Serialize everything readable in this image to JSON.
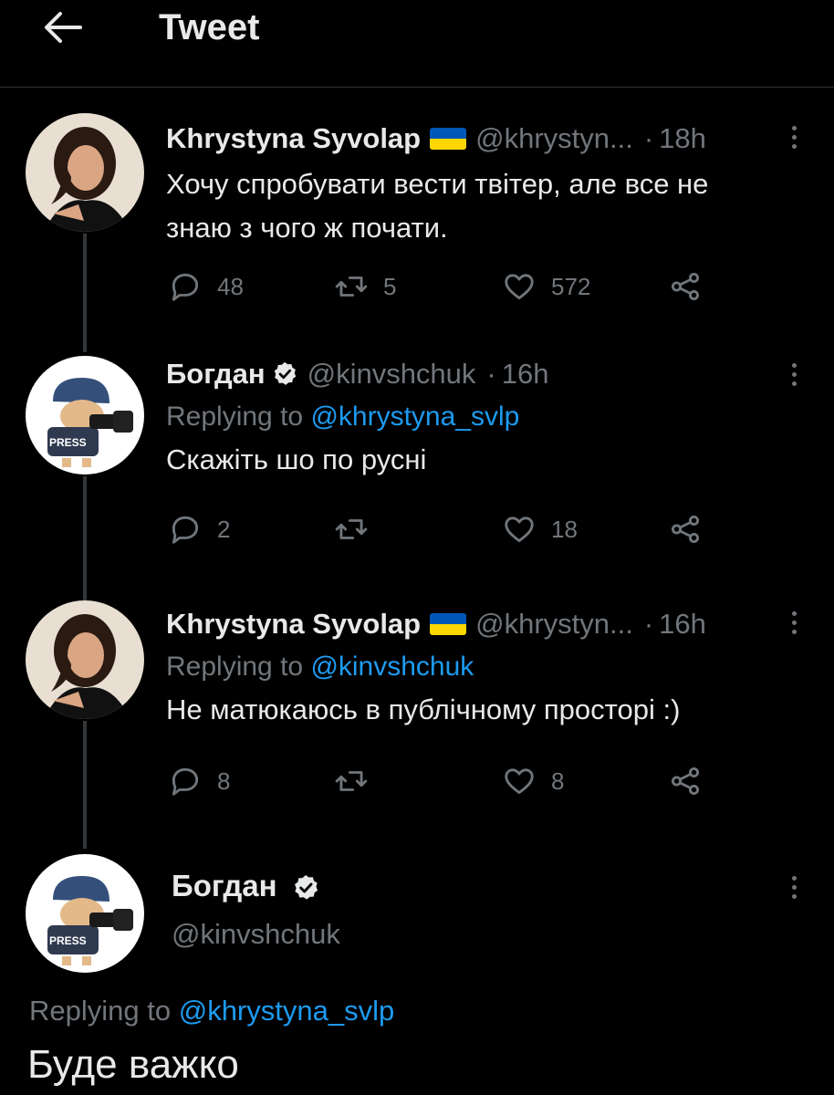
{
  "header": {
    "title": "Tweet",
    "back_icon": "arrow-left-icon"
  },
  "colors": {
    "background": "#000000",
    "text": "#e7e9ea",
    "muted": "#71767b",
    "link": "#1d9bf0",
    "flag_blue": "#0057b7",
    "flag_yellow": "#ffd700"
  },
  "tweets": [
    {
      "name": "Khrystyna Syvolap",
      "handle": "@khrystyn...",
      "dot": "·",
      "time": "18h",
      "replying_prefix": "",
      "replying_to": "",
      "text_line1": "Хочу спробувати вести твітер, але все не",
      "text_line2": "знаю з чого ж почати.",
      "replies": "48",
      "retweets": "5",
      "likes": "572"
    },
    {
      "name": "Богдан",
      "handle": "@kinvshchuk",
      "dot": "·",
      "time": "16h",
      "replying_prefix": "Replying to",
      "replying_to": "@khrystyna_svlp",
      "text": "Скажіть шо по русні",
      "replies": "2",
      "retweets": "",
      "likes": "18"
    },
    {
      "name": "Khrystyna Syvolap",
      "handle": "@khrystyn...",
      "dot": "·",
      "time": "16h",
      "replying_prefix": "Replying to",
      "replying_to": "@kinvshchuk",
      "text": "Не матюкаюсь в публічному просторі :)",
      "replies": "8",
      "retweets": "",
      "likes": "8"
    }
  ],
  "main_tweet": {
    "name": "Богдан",
    "handle": "@kinvshchuk",
    "replying_prefix": "Replying to",
    "replying_to": "@khrystyna_svlp",
    "text": "Буде важко"
  }
}
